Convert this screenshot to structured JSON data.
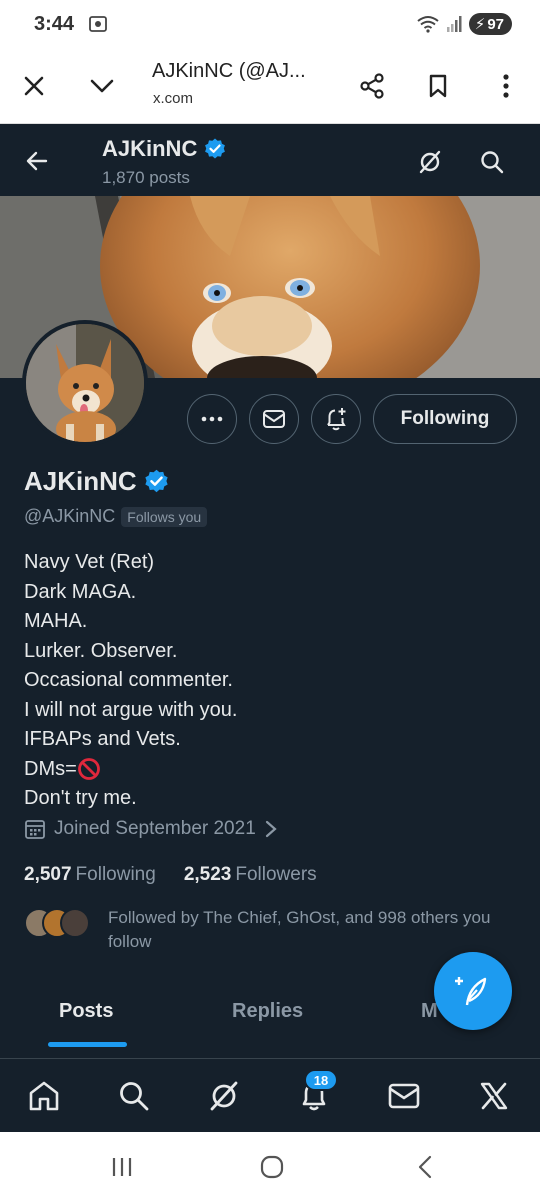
{
  "status_bar": {
    "time": "3:44",
    "battery": "97"
  },
  "browser": {
    "title": "AJKinNC (@AJ...",
    "url": "x.com"
  },
  "header": {
    "name": "AJKinNC",
    "posts": "1,870 posts"
  },
  "profile": {
    "name": "AJKinNC",
    "handle": "@AJKinNC",
    "follows_you": "Follows you",
    "following_button": "Following",
    "bio": [
      "Navy Vet (Ret)",
      "Dark MAGA.",
      "MAHA.",
      "Lurker. Observer.",
      "Occasional commenter.",
      "I will not argue with you.",
      "IFBAPs and Vets.",
      "DMs=",
      "Don't try me."
    ],
    "joined": "Joined September 2021",
    "following_count": "2,507",
    "following_label": "Following",
    "followers_count": "2,523",
    "followers_label": "Followers",
    "followed_by": "Followed by The Chief, GhOst, and 998 others you follow"
  },
  "tabs": [
    "Posts",
    "Replies",
    "M"
  ],
  "nav": {
    "notification_badge": "18"
  },
  "colors": {
    "background": "#15202b",
    "accent": "#1d9bf0",
    "text": "#e7e9ea",
    "muted": "#8b98a5"
  }
}
